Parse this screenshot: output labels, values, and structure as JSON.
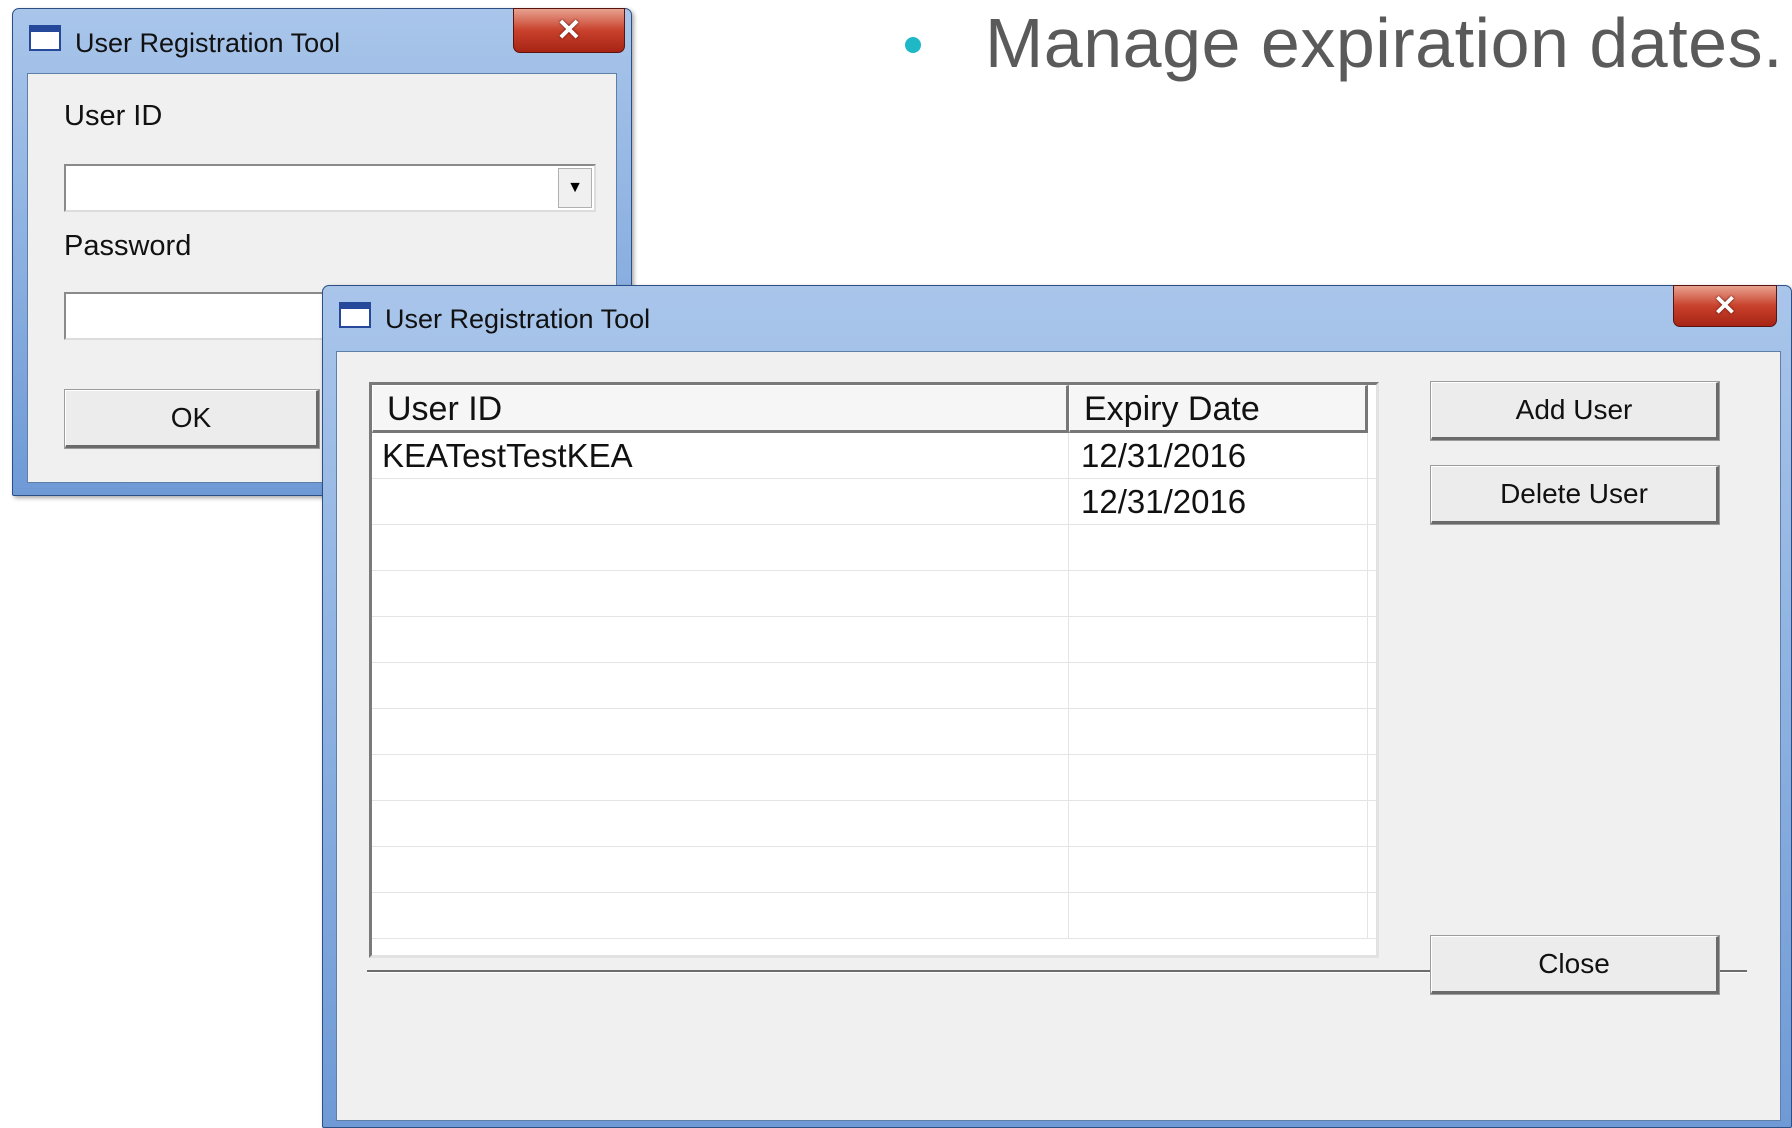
{
  "slide": {
    "bullet_text": "Manage expiration dates.",
    "bullet_color": "#1fb8c6"
  },
  "login_window": {
    "title": "User Registration Tool",
    "close_glyph": "✕",
    "user_id_label": "User ID",
    "user_id_value": "",
    "dropdown_glyph": "▼",
    "password_label": "Password",
    "password_value": "",
    "ok_label": "OK"
  },
  "manager_window": {
    "title": "User Registration Tool",
    "close_glyph": "✕",
    "table": {
      "columns": [
        "User ID",
        "Expiry Date"
      ],
      "rows": [
        {
          "user_id": "KEATestTestKEA",
          "expiry": "12/31/2016"
        },
        {
          "user_id": "",
          "expiry": "12/31/2016"
        },
        {
          "user_id": "",
          "expiry": ""
        },
        {
          "user_id": "",
          "expiry": ""
        },
        {
          "user_id": "",
          "expiry": ""
        },
        {
          "user_id": "",
          "expiry": ""
        },
        {
          "user_id": "",
          "expiry": ""
        },
        {
          "user_id": "",
          "expiry": ""
        },
        {
          "user_id": "",
          "expiry": ""
        },
        {
          "user_id": "",
          "expiry": ""
        },
        {
          "user_id": "",
          "expiry": ""
        }
      ]
    },
    "add_user_label": "Add User",
    "delete_user_label": "Delete User",
    "close_label": "Close"
  },
  "icons": {
    "app_icon": "window-icon",
    "close_icon": "close-icon",
    "dropdown_icon": "chevron-down-icon"
  }
}
